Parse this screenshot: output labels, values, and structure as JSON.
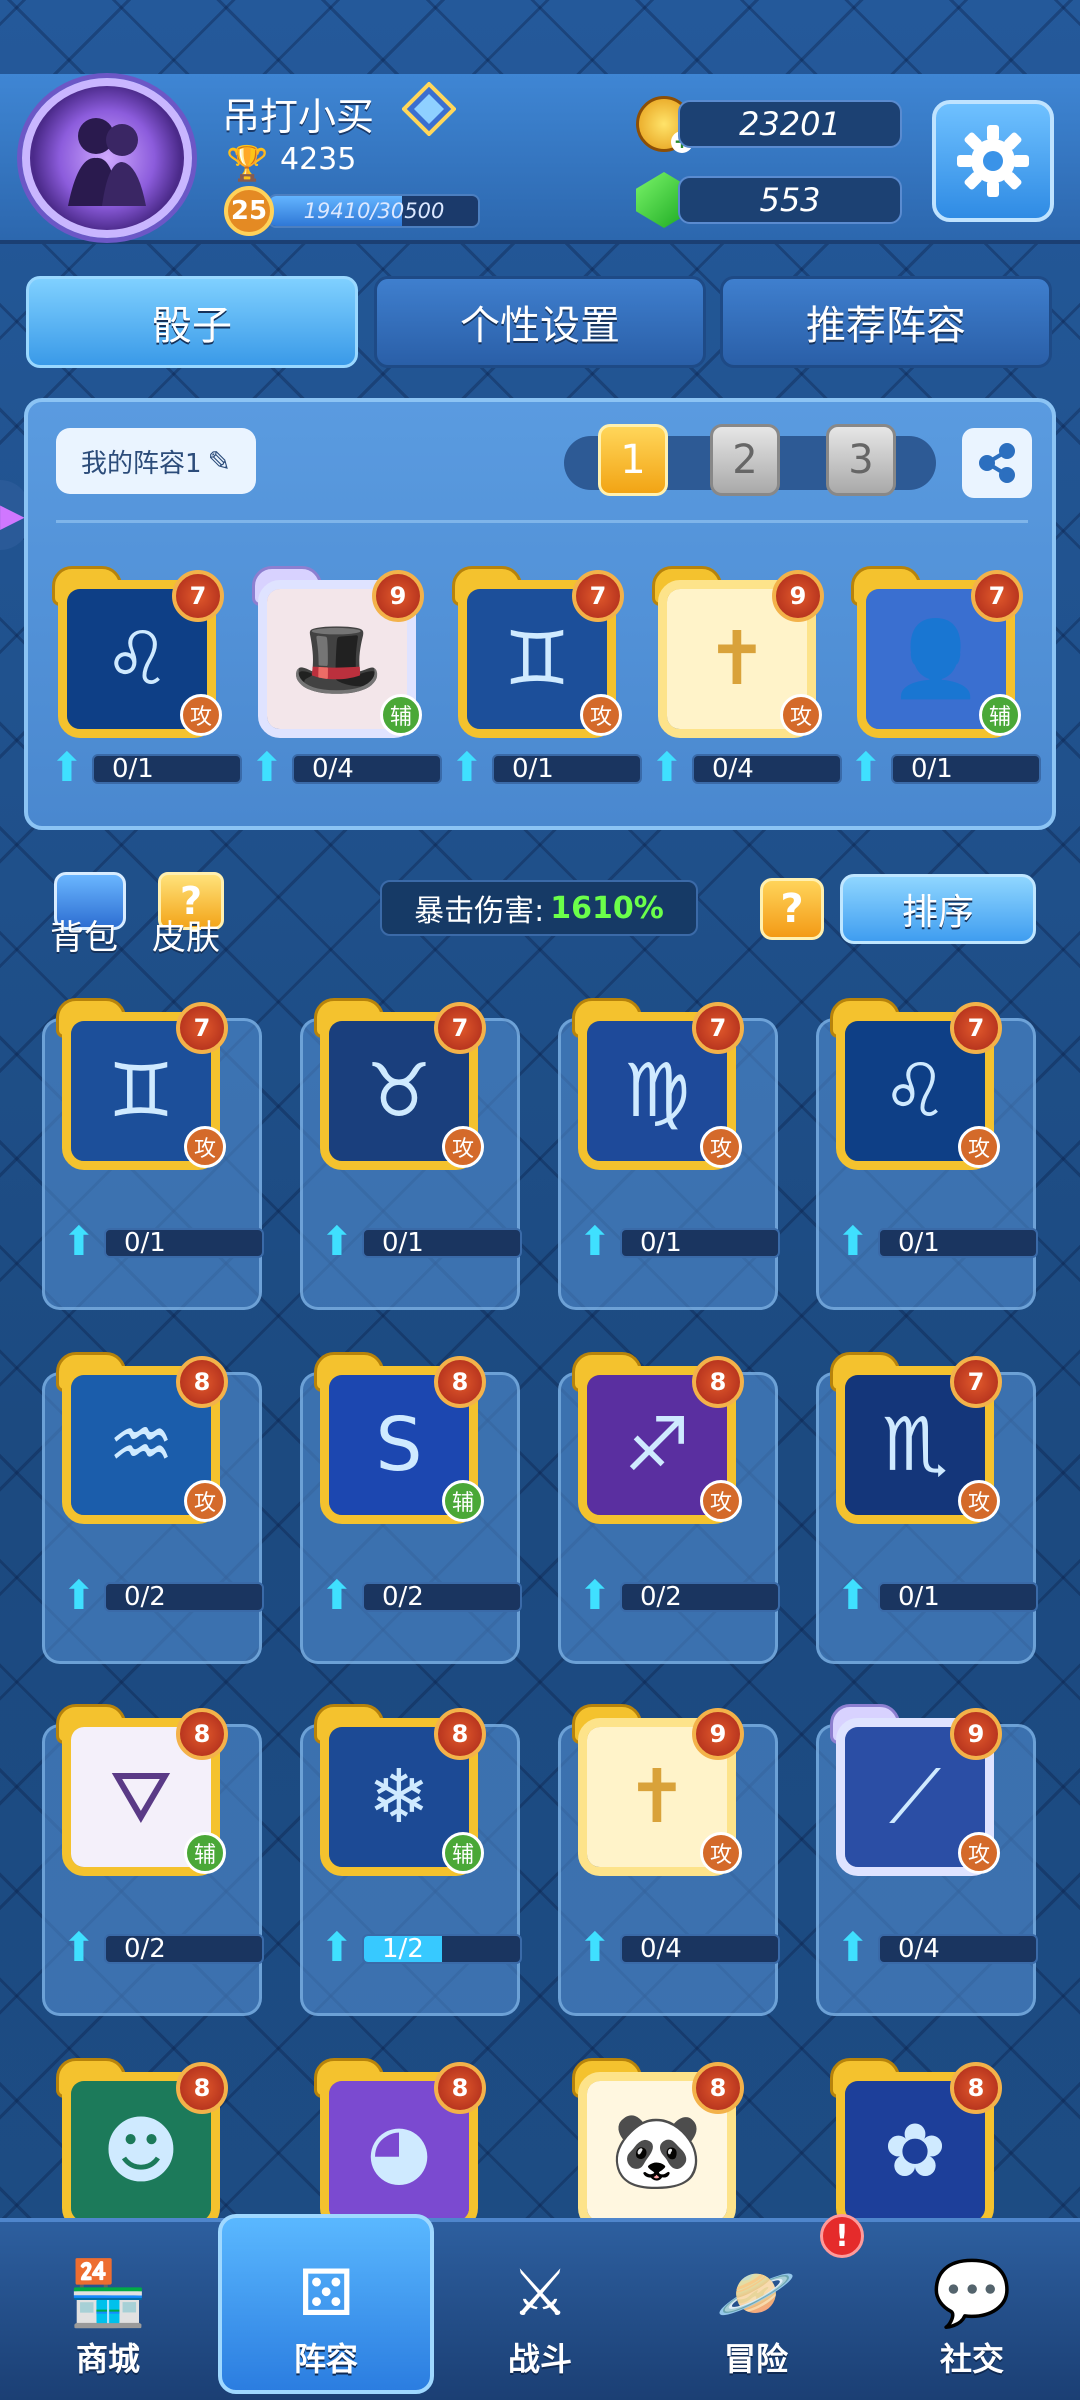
{
  "player": {
    "name": "吊打小买",
    "trophies": "4235",
    "level": "25",
    "xp_text": "19410/30500",
    "xp_fraction": 0.636
  },
  "currency": {
    "coins": "23201",
    "gems": "553"
  },
  "tabs": [
    "骰子",
    "个性设置",
    "推荐阵容"
  ],
  "deck": {
    "name": "我的阵容1",
    "slots": [
      "1",
      "2",
      "3"
    ],
    "active_slot": 0,
    "dice": [
      {
        "icon": "lion-icon",
        "level": "7",
        "role": "攻",
        "progress": "0/1",
        "frame": "normal"
      },
      {
        "icon": "hat-icon",
        "level": "9",
        "role": "辅",
        "progress": "0/4",
        "frame": "silver"
      },
      {
        "icon": "twins-icon",
        "level": "7",
        "role": "攻",
        "progress": "0/1",
        "frame": "normal"
      },
      {
        "icon": "cross-icon",
        "level": "9",
        "role": "攻",
        "progress": "0/4",
        "frame": "gold"
      },
      {
        "icon": "body-icon",
        "level": "7",
        "role": "辅",
        "progress": "0/1",
        "frame": "normal"
      }
    ]
  },
  "side": {
    "bag_label": "背包",
    "skin_label": "皮肤",
    "help_glyph": "?"
  },
  "crit": {
    "label": "暴击伤害:",
    "value": "1610%"
  },
  "sort_label": "排序",
  "collection": [
    {
      "icon": "twins-icon",
      "level": "7",
      "role": "攻",
      "progress": "0/1",
      "fill": 0,
      "frame": "normal"
    },
    {
      "icon": "bull-icon",
      "level": "7",
      "role": "攻",
      "progress": "0/1",
      "fill": 0,
      "frame": "normal"
    },
    {
      "icon": "maiden-icon",
      "level": "7",
      "role": "攻",
      "progress": "0/1",
      "fill": 0,
      "frame": "normal"
    },
    {
      "icon": "lion-icon",
      "level": "7",
      "role": "攻",
      "progress": "0/1",
      "fill": 0,
      "frame": "normal"
    },
    {
      "icon": "aquarius-icon",
      "level": "8",
      "role": "攻",
      "progress": "0/2",
      "fill": 0,
      "frame": "normal"
    },
    {
      "icon": "coin-icon",
      "level": "8",
      "role": "辅",
      "progress": "0/2",
      "fill": 0,
      "frame": "normal"
    },
    {
      "icon": "archer-icon",
      "level": "8",
      "role": "攻",
      "progress": "0/2",
      "fill": 0,
      "frame": "normal"
    },
    {
      "icon": "scorpion-icon",
      "level": "7",
      "role": "攻",
      "progress": "0/1",
      "fill": 0,
      "frame": "normal"
    },
    {
      "icon": "witch-hat-icon",
      "level": "8",
      "role": "辅",
      "progress": "0/2",
      "fill": 0,
      "frame": "normal"
    },
    {
      "icon": "snowflake-icon",
      "level": "8",
      "role": "辅",
      "progress": "1/2",
      "fill": 0.5,
      "frame": "normal"
    },
    {
      "icon": "cross-icon",
      "level": "9",
      "role": "攻",
      "progress": "0/4",
      "fill": 0,
      "frame": "gold"
    },
    {
      "icon": "blade-icon",
      "level": "9",
      "role": "攻",
      "progress": "0/4",
      "fill": 0,
      "frame": "silver"
    },
    {
      "icon": "ghost-icon",
      "level": "8",
      "role": "",
      "progress": "",
      "fill": 0,
      "frame": "normal"
    },
    {
      "icon": "purple-face-icon",
      "level": "8",
      "role": "",
      "progress": "",
      "fill": 0,
      "frame": "normal"
    },
    {
      "icon": "panda-icon",
      "level": "8",
      "role": "",
      "progress": "",
      "fill": 0,
      "frame": "gold"
    },
    {
      "icon": "lotus-icon",
      "level": "8",
      "role": "",
      "progress": "",
      "fill": 0,
      "frame": "normal"
    }
  ],
  "nav": [
    {
      "label": "商城",
      "icon": "shop-icon"
    },
    {
      "label": "阵容",
      "icon": "dice-icon",
      "active": true
    },
    {
      "label": "战斗",
      "icon": "swords-icon"
    },
    {
      "label": "冒险",
      "icon": "planet-icon",
      "alert": "!"
    },
    {
      "label": "社交",
      "icon": "chat-icon"
    }
  ],
  "colors": {
    "accent": "#3a9ae8",
    "attack": "#d46a2a",
    "support": "#4aa837",
    "crit": "#6bff4a"
  }
}
